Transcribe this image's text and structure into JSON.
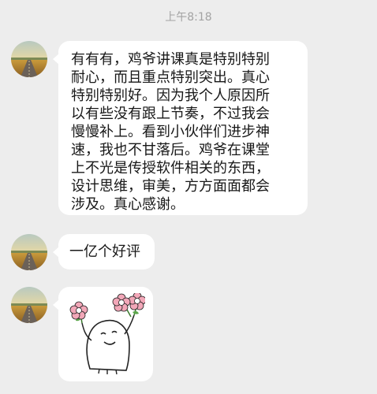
{
  "chat": {
    "timestamp": "上午8:18",
    "messages": [
      {
        "type": "text",
        "sender": "other",
        "avatar_icon": "road-landscape-avatar-icon",
        "text": "有有有，鸡爷讲课真是特别特别\n耐心，而且重点特别突出。真心\n特别特别好。因为我个人原因所\n以有些没有跟上节奏，不过我会\n慢慢补上。看到小伙伴们进步神\n速，我也不甘落后。鸡爷在课堂\n上不光是传授软件相关的东西，\n设计思维，审美，方方面面都会\n涉及。真心感谢。"
      },
      {
        "type": "text",
        "sender": "other",
        "avatar_icon": "road-landscape-avatar-icon",
        "text": "一亿个好评"
      },
      {
        "type": "sticker",
        "sender": "other",
        "avatar_icon": "road-landscape-avatar-icon",
        "sticker_icon": "flower-holding-character-sticker"
      }
    ]
  },
  "colors": {
    "background": "#ededed",
    "bubble": "#ffffff",
    "text": "#181818",
    "timestamp": "#a3a3a3"
  }
}
